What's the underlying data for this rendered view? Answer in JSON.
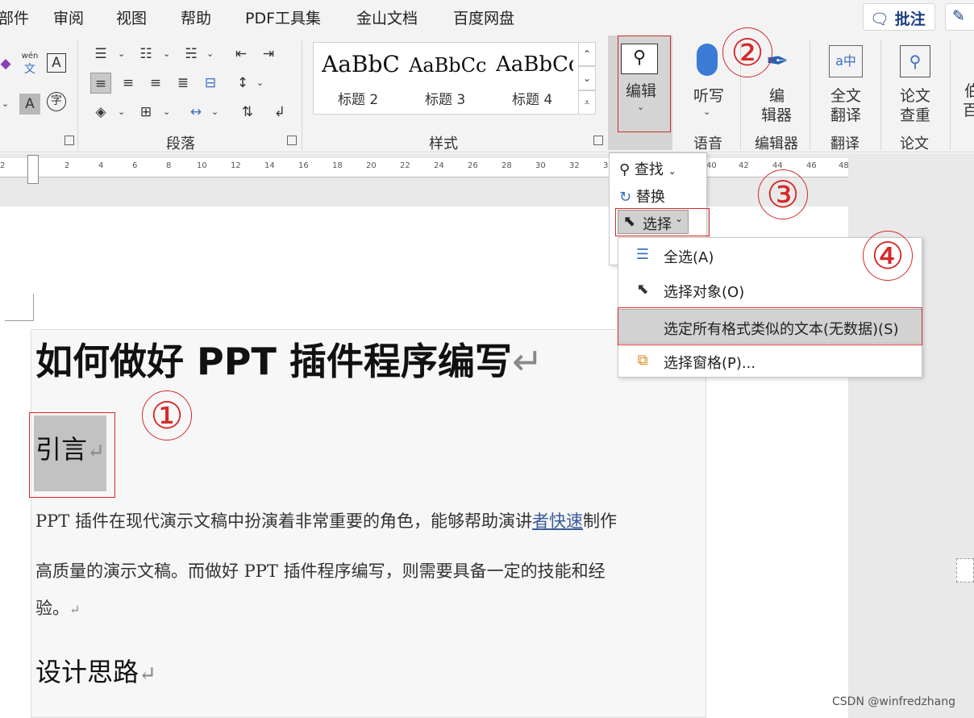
{
  "menubar": {
    "items": [
      "部件",
      "审阅",
      "视图",
      "帮助",
      "PDF工具集",
      "金山文档",
      "百度网盘"
    ],
    "comment_button": "批注"
  },
  "ribbon": {
    "groups": {
      "paragraph": "段落",
      "styles": "样式",
      "voice": "语音",
      "editor": "编辑器",
      "translate": "翻译",
      "paper": "论文"
    },
    "font_small": {
      "wen": "wén",
      "wen_char": "文",
      "a_box": "A",
      "a_shade": "A",
      "zi": "字"
    },
    "styles": [
      {
        "sample": "AaBbC",
        "name": "标题 2"
      },
      {
        "sample": "AaBbCc",
        "name": "标题 3"
      },
      {
        "sample": "AaBbCc",
        "name": "标题 4"
      }
    ],
    "buttons": {
      "edit": "编辑",
      "dictate": "听写",
      "editor_line1": "编",
      "editor_line2": "辑器",
      "fulltext_line1": "全文",
      "fulltext_line2": "翻译",
      "paper_line1": "论文",
      "paper_line2": "查重",
      "cut_off_line1": "伯",
      "cut_off_line2": "百"
    }
  },
  "ruler": {
    "numbers": [
      "2",
      "2",
      "4",
      "6",
      "8",
      "10",
      "12",
      "14",
      "16",
      "18",
      "20",
      "22",
      "24",
      "26",
      "28",
      "30",
      "32",
      "3",
      "40",
      "42",
      "44",
      "46",
      "48"
    ]
  },
  "edit_menu": {
    "find": "查找",
    "replace": "替换",
    "select": "选择"
  },
  "select_menu": {
    "items": [
      {
        "label": "全选(A)",
        "icon": "select-all-icon"
      },
      {
        "label": "选择对象(O)",
        "icon": "pointer-icon"
      },
      {
        "label": "选定所有格式类似的文本(无数据)(S)",
        "icon": ""
      },
      {
        "label": "选择窗格(P)...",
        "icon": "selection-pane-icon"
      }
    ]
  },
  "annotations": [
    "①",
    "②",
    "③",
    "④"
  ],
  "document": {
    "title": "如何做好 PPT 插件程序编写",
    "heading_intro": "引言",
    "para_line1_a": "PPT 插件在现代演示文稿中扮演着非常重要的角色，能够帮助演讲",
    "para_line1_b": "者快速",
    "para_line1_c": "制作",
    "para_line2": "高质量的演示文稿。而做好 PPT 插件程序编写，则需要具备一定的技能和经",
    "para_line3": "验。",
    "heading_design": "设计思路",
    "pilcrow": "↵"
  },
  "watermark": "CSDN @winfredzhang",
  "colors": {
    "annotation_red": "#d42a2a",
    "highlight_gray": "#c2c2c2",
    "ribbon_bg": "#f3f3f3"
  }
}
